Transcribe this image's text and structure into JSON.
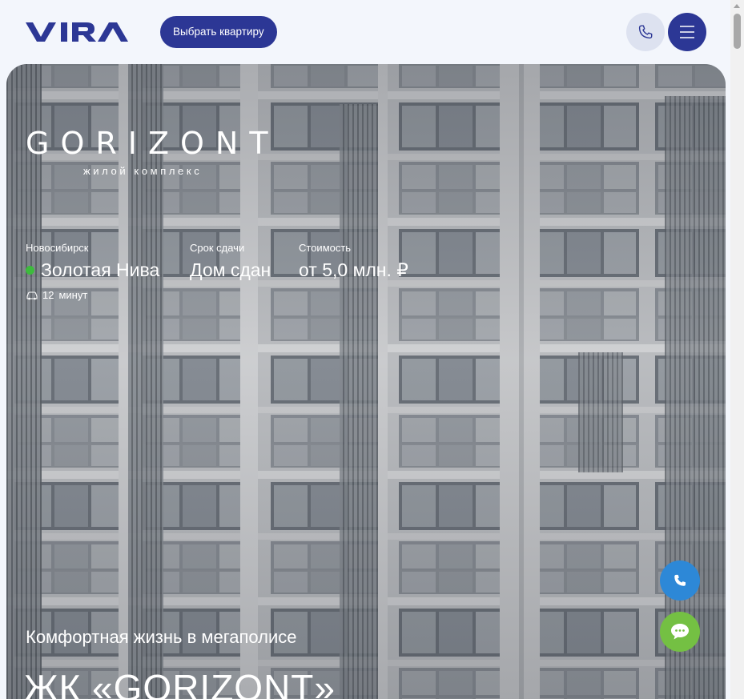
{
  "header": {
    "logo_text": "VIRA",
    "cta_label": "Выбрать квартиру",
    "phone_icon": "phone-icon",
    "menu_icon": "hamburger-icon"
  },
  "hero": {
    "brand_name": "GORIZONT",
    "brand_subtitle": "жилой комплекс",
    "facts": [
      {
        "label": "Новосибирск",
        "value": "Золотая Нива"
      },
      {
        "label": "Срок сдачи",
        "value": "Дом сдан"
      },
      {
        "label": "Стоимость",
        "value": "от 5,0 млн. ₽"
      }
    ],
    "travel": {
      "icon": "car-icon",
      "number": "12",
      "unit": "минут"
    },
    "tagline": "Комфортная жизнь в мегаполисе",
    "title": "ЖК «GORIZONT»"
  },
  "widgets": {
    "call_icon": "phone-icon",
    "chat_icon": "chat-icon"
  },
  "colors": {
    "brand": "#2c3795",
    "metro": "#3dbb3d",
    "call": "#2d88d7",
    "chat": "#74c043",
    "background": "#f3f6fc"
  }
}
